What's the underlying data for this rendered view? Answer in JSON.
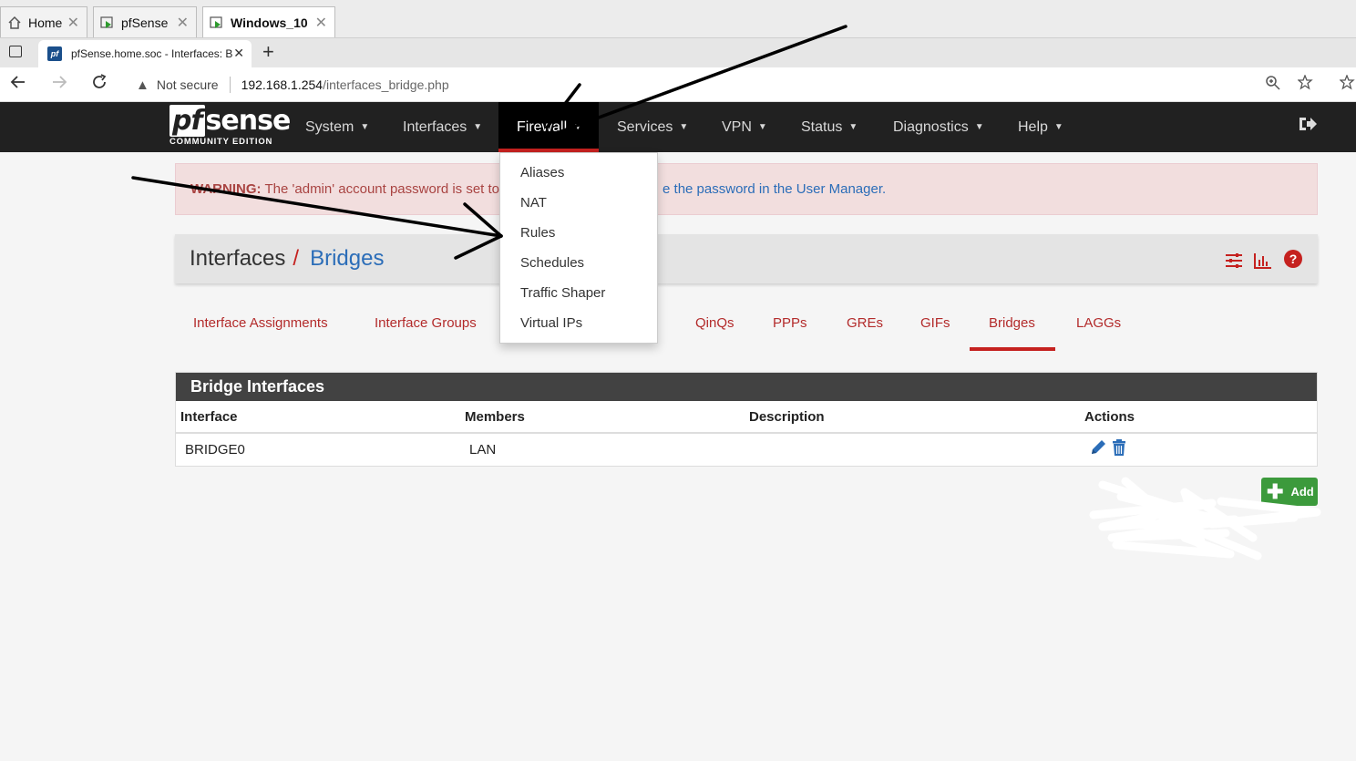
{
  "vm_tabs": [
    {
      "label": "Home",
      "icon": "home-icon"
    },
    {
      "label": "pfSense",
      "icon": "vm-icon"
    },
    {
      "label": "Windows_10",
      "icon": "vm-icon"
    }
  ],
  "browser": {
    "tab_title": "pfSense.home.soc - Interfaces: B",
    "favicon_text": "pf",
    "security": "Not secure",
    "url_host": "192.168.1.254",
    "url_path": "/interfaces_bridge.php"
  },
  "logo": {
    "main": "sense",
    "pf": "pf",
    "sub": "COMMUNITY EDITION"
  },
  "nav": {
    "items": [
      "System",
      "Interfaces",
      "Firewall",
      "Services",
      "VPN",
      "Status",
      "Diagnostics",
      "Help"
    ],
    "active": "Firewall"
  },
  "firewall_menu": [
    "Aliases",
    "NAT",
    "Rules",
    "Schedules",
    "Traffic Shaper",
    "Virtual IPs"
  ],
  "warning": {
    "label": "WARNING:",
    "text": "The 'admin' account password is set to",
    "link": "e the password in the User Manager."
  },
  "breadcrumb": {
    "section": "Interfaces",
    "page": "Bridges"
  },
  "sub_tabs": [
    "Interface Assignments",
    "Interface Groups",
    "QinQs",
    "PPPs",
    "GREs",
    "GIFs",
    "Bridges",
    "LAGGs"
  ],
  "active_sub_tab": "Bridges",
  "table": {
    "title": "Bridge Interfaces",
    "columns": [
      "Interface",
      "Members",
      "Description",
      "Actions"
    ],
    "rows": [
      {
        "interface": "BRIDGE0",
        "members": "LAN",
        "description": ""
      }
    ]
  },
  "add_button": "Add",
  "colors": {
    "navbar": "#212121",
    "accent_red": "#c5211f",
    "link_blue": "#2b6db8",
    "add_green": "#3c9a3c",
    "warning_bg": "#f2dede"
  }
}
